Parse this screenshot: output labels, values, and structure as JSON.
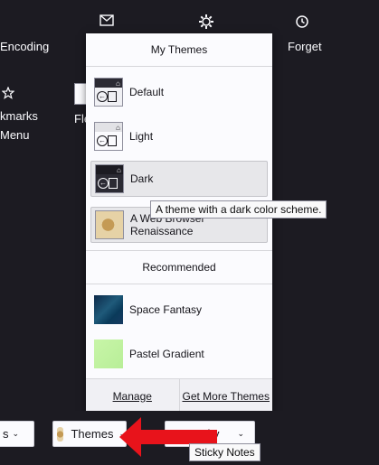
{
  "background": {
    "items": [
      {
        "label": "Encoding"
      },
      {
        "label": "Forget"
      },
      {
        "label": "kmarks"
      },
      {
        "label": "Menu"
      },
      {
        "label": "Fle"
      }
    ]
  },
  "themes_panel": {
    "header": "My Themes",
    "themes": [
      {
        "label": "Default"
      },
      {
        "label": "Light"
      },
      {
        "label": "Dark"
      },
      {
        "label": "A Web Browser Renaissance"
      }
    ],
    "recommended_header": "Recommended",
    "recommended": [
      {
        "label": "Space Fantasy"
      },
      {
        "label": "Pastel Gradient"
      }
    ],
    "footer": {
      "manage": "Manage",
      "get_more": "Get More Themes"
    }
  },
  "tooltip_dark": "A theme with a dark color scheme.",
  "bottom_bar": {
    "themes_button": "Themes",
    "density_fragment": "sity",
    "left_fragment": "s",
    "tooltip": "Sticky Notes"
  },
  "colors": {
    "background": "#1c1b22",
    "panel": "#fbfbfe",
    "arrow": "#e8131b",
    "selected": "#e7e7ea"
  }
}
